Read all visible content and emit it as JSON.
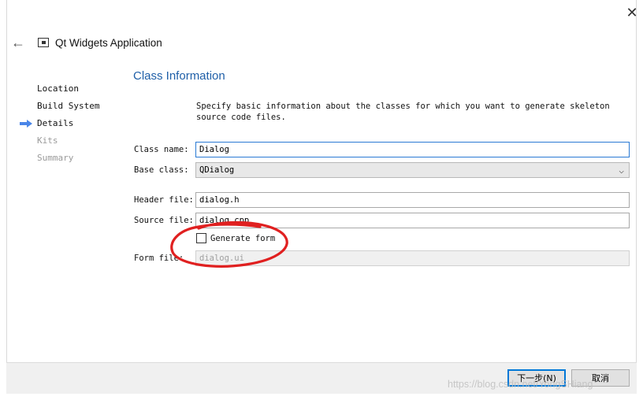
{
  "window": {
    "title": "Qt Widgets Application",
    "close_glyph": "✕",
    "back_glyph": "←"
  },
  "sidebar": {
    "items": [
      {
        "label": "Location",
        "state": "done"
      },
      {
        "label": "Build System",
        "state": "done"
      },
      {
        "label": "Details",
        "state": "current"
      },
      {
        "label": "Kits",
        "state": "todo"
      },
      {
        "label": "Summary",
        "state": "todo"
      }
    ]
  },
  "main": {
    "section_title": "Class Information",
    "description": "Specify basic information about the classes for which you want to generate skeleton source code files.",
    "class_name": {
      "label": "Class name:",
      "value": "Dialog"
    },
    "base_class": {
      "label": "Base class:",
      "value": "QDialog"
    },
    "header_file": {
      "label": "Header file:",
      "value": "dialog.h"
    },
    "source_file": {
      "label": "Source file:",
      "value": "dialog.cpp"
    },
    "generate_form": {
      "label": "Generate form",
      "checked": false
    },
    "form_file": {
      "label": "Form file:",
      "value": "dialog.ui"
    }
  },
  "buttons": {
    "next": "下一步(N)",
    "cancel": "取消"
  },
  "watermark": "https://blog.csdn.net/YongSHiang",
  "colors": {
    "accent_title": "#1f5fa8",
    "focus_border": "#2a7ad4",
    "annotation": "#e02020",
    "step_arrow": "#4a86e8"
  }
}
